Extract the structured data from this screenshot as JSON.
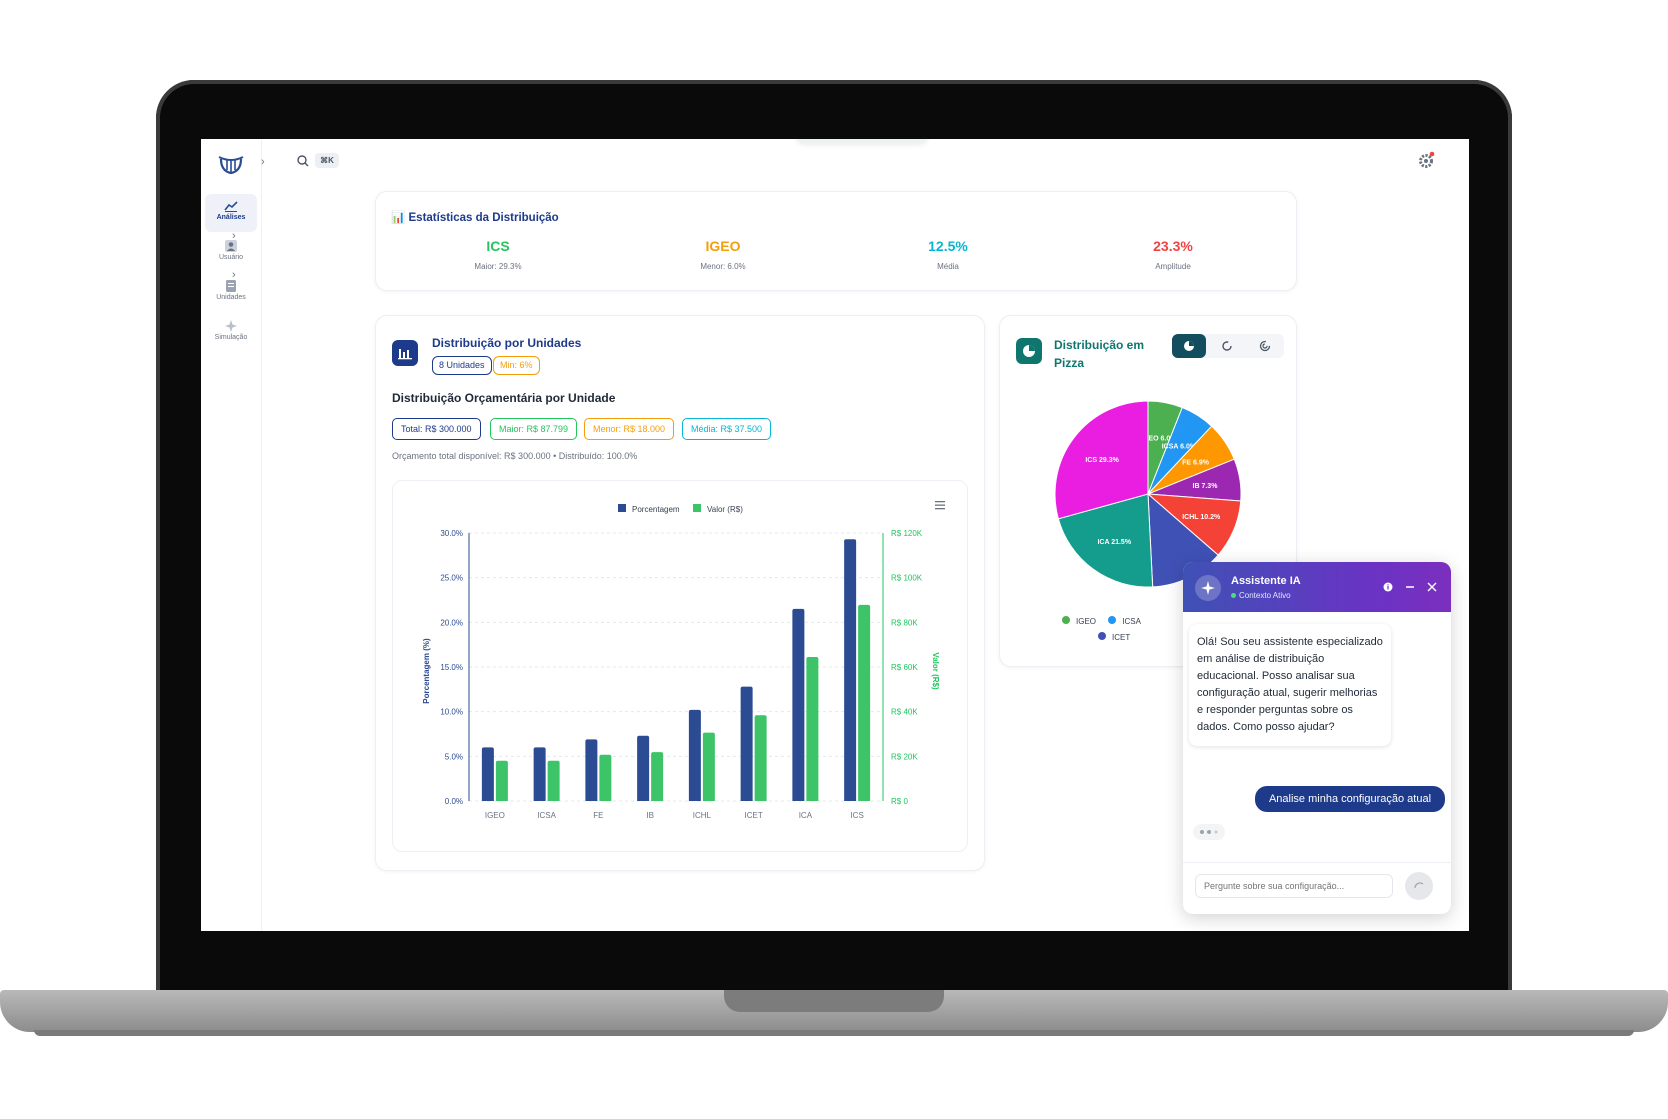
{
  "header": {
    "search_shortcut": "⌘K",
    "settings_icon": "gear-icon"
  },
  "sidebar": {
    "items": [
      {
        "label": "Análises",
        "icon": "chart-line-icon",
        "active": true
      },
      {
        "label": "Usuário",
        "icon": "user-icon"
      },
      {
        "label": "Unidades",
        "icon": "building-icon"
      },
      {
        "label": "Simulação",
        "icon": "sparkle-icon"
      }
    ]
  },
  "stats": {
    "title": "📊 Estatísticas da Distribuição",
    "items": [
      {
        "value": "ICS",
        "label": "Maior: 29.3%",
        "color": "#22c55e"
      },
      {
        "value": "IGEO",
        "label": "Menor: 6.0%",
        "color": "#f59e0b"
      },
      {
        "value": "12.5%",
        "label": "Média",
        "color": "#06b6d4"
      },
      {
        "value": "23.3%",
        "label": "Amplitude",
        "color": "#ef4444"
      }
    ]
  },
  "units_card": {
    "title": "Distribuição por Unidades",
    "badge_units": "8 Unidades",
    "badge_min": "Min: 6%",
    "subtitle": "Distribuição Orçamentária por Unidade",
    "pills": {
      "total": "Total: R$ 300.000",
      "max": "Maior: R$ 87.799",
      "min": "Menor: R$ 18.000",
      "avg": "Média: R$ 37.500"
    },
    "summary": "Orçamento total disponível: R$ 300.000 • Distribuído: 100.0%"
  },
  "chart_data": {
    "type": "bar",
    "categories": [
      "IGEO",
      "ICSA",
      "FE",
      "IB",
      "ICHL",
      "ICET",
      "ICA",
      "ICS"
    ],
    "series": [
      {
        "name": "Porcentagem",
        "values": [
          6.0,
          6.0,
          6.9,
          7.3,
          10.2,
          12.8,
          21.5,
          29.3
        ],
        "color": "#2b4c93",
        "axis": "left"
      },
      {
        "name": "Valor (R$)",
        "values": [
          18000,
          18000,
          20700,
          21900,
          30600,
          38400,
          64500,
          87799
        ],
        "color": "#3dc468",
        "axis": "right"
      }
    ],
    "ylabel": "Porcentagem (%)",
    "y2label": "Valor (R$)",
    "ylim": [
      0,
      30
    ],
    "y2lim": [
      0,
      120000
    ],
    "yticks": [
      "0.0%",
      "5.0%",
      "10.0%",
      "15.0%",
      "20.0%",
      "25.0%",
      "30.0%"
    ],
    "y2ticks": [
      "R$ 0",
      "R$ 20K",
      "R$ 40K",
      "R$ 60K",
      "R$ 80K",
      "R$ 100K",
      "R$ 120K"
    ],
    "legend": "top-center",
    "grid": true
  },
  "pie_card": {
    "title_line1": "Distribuição em",
    "title_line2": "Pizza",
    "pie": [
      {
        "label": "IGEO",
        "value": 6.0,
        "text": "IGEO 6.0%",
        "color": "#4caf50"
      },
      {
        "label": "ICSA",
        "value": 6.0,
        "text": "ICSA 6.0%",
        "color": "#2196f3"
      },
      {
        "label": "FE",
        "value": 6.9,
        "text": "FE 6.9%",
        "color": "#ff9800"
      },
      {
        "label": "IB",
        "value": 7.3,
        "text": "IB 7.3%",
        "color": "#9c27b0"
      },
      {
        "label": "ICHL",
        "value": 10.2,
        "text": "ICHL 10.2%",
        "color": "#f44336"
      },
      {
        "label": "ICET",
        "value": 12.8,
        "text": "",
        "color": "#3f51b5"
      },
      {
        "label": "ICA",
        "value": 21.5,
        "text": "ICA 21.5%",
        "color": "#149c8c"
      },
      {
        "label": "ICS",
        "value": 29.3,
        "text": "ICS 29.3%",
        "color": "#e91ee0"
      }
    ],
    "legend": [
      "IGEO",
      "ICSA",
      "ICET"
    ]
  },
  "chat": {
    "title": "Assistente IA",
    "status": "Contexto Ativo",
    "bot_message": "Olá! Sou seu assistente especializado em análise de distribuição educacional. Posso analisar sua configuração atual, sugerir melhorias e responder perguntas sobre os dados. Como posso ajudar?",
    "user_message": "Analise minha configuração atual",
    "input_placeholder": "Pergunte sobre sua configuração..."
  }
}
